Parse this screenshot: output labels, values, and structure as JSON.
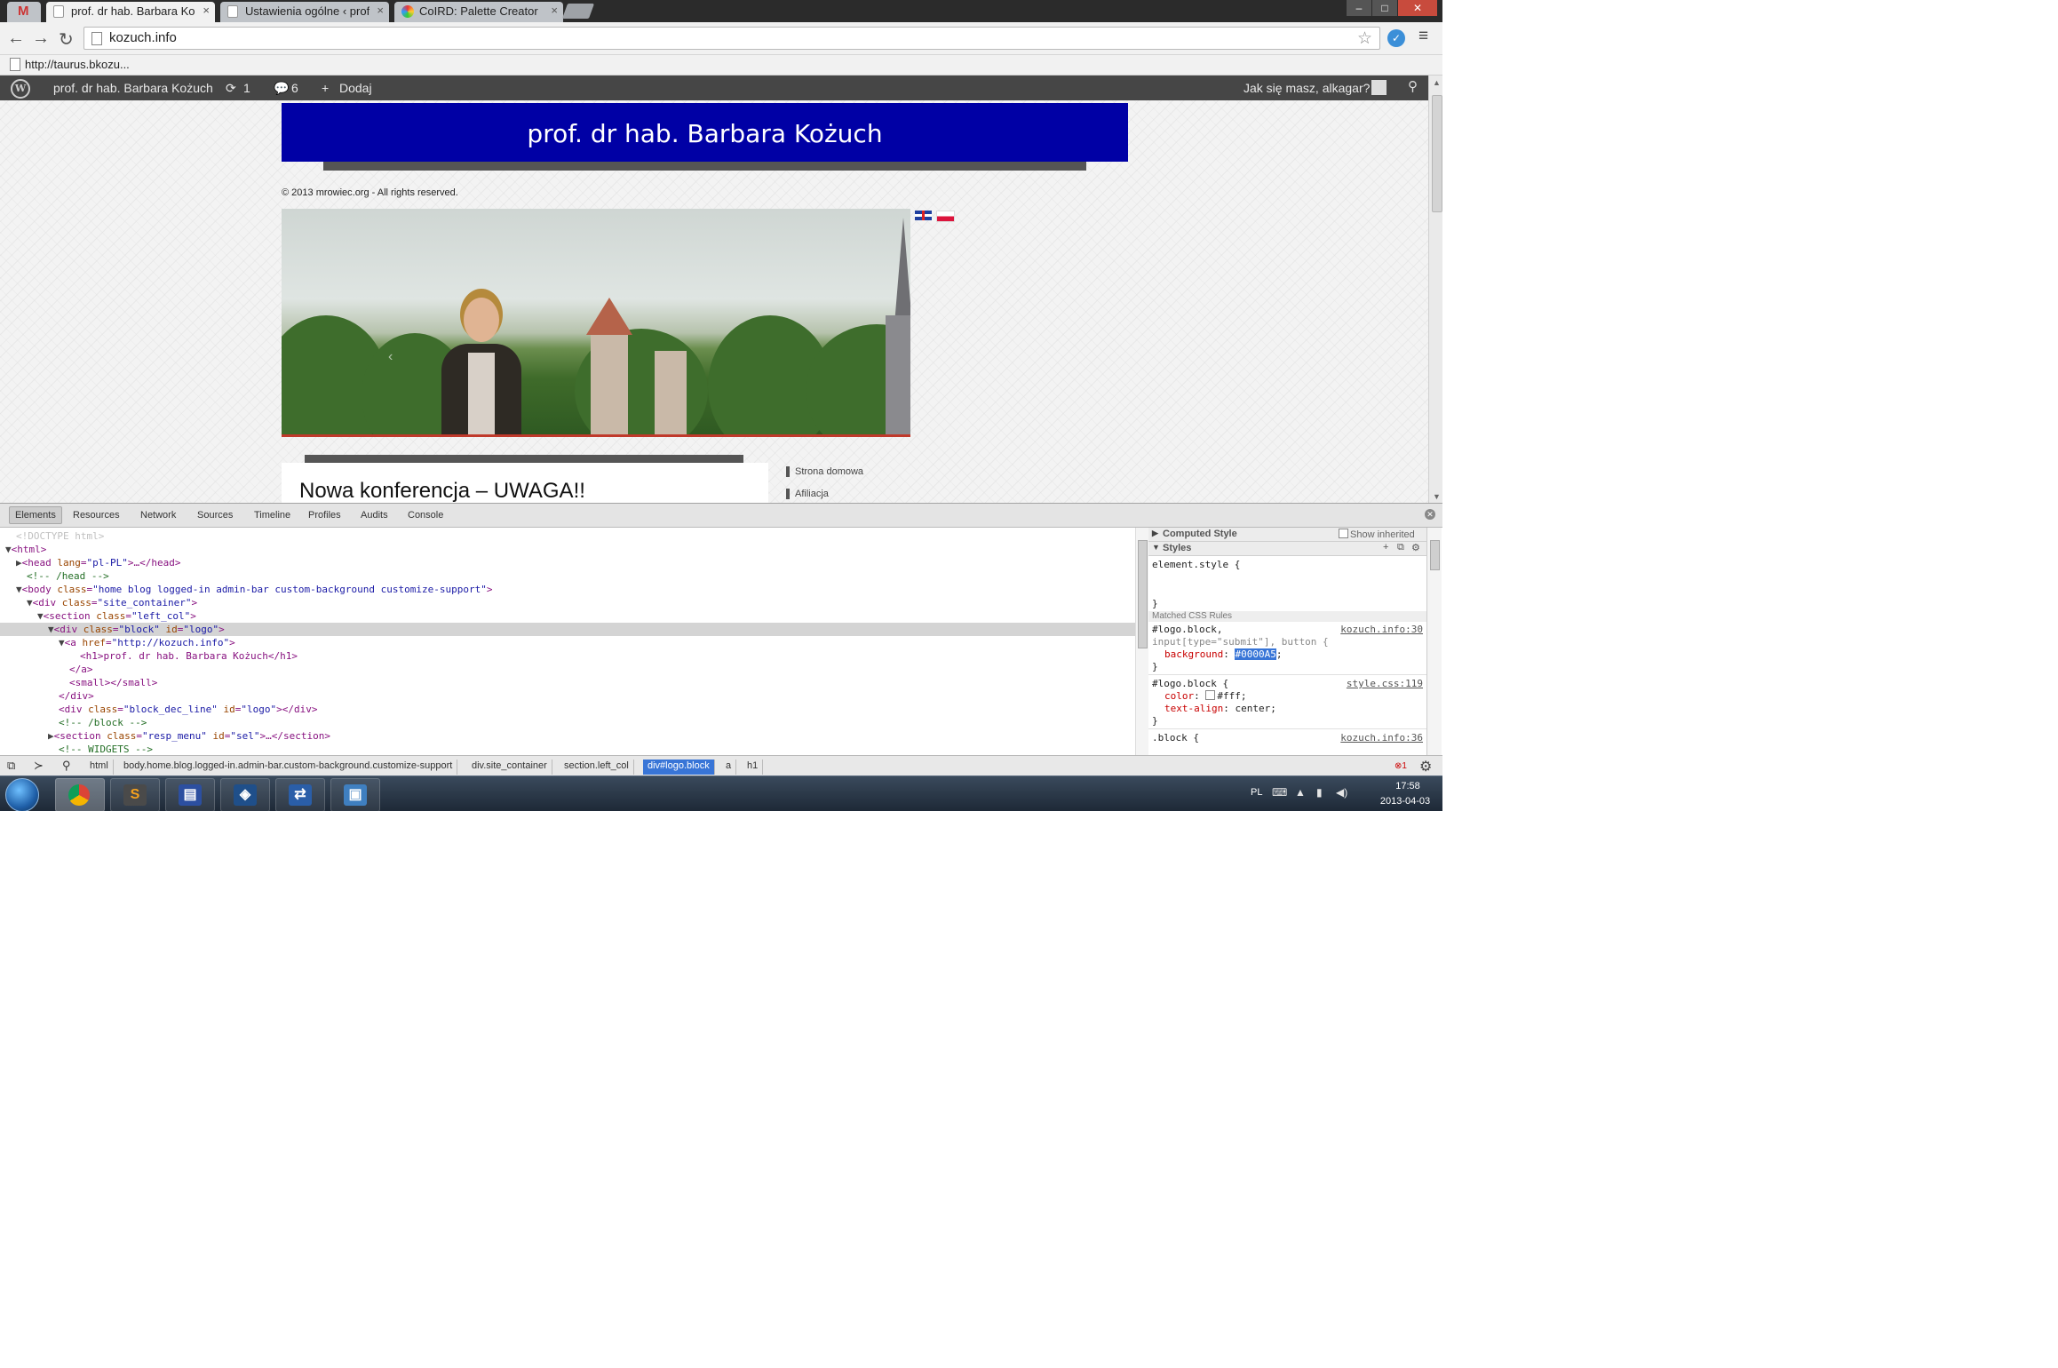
{
  "browser": {
    "tabs": [
      {
        "title": "prof. dr hab. Barbara Kożuc",
        "active": true
      },
      {
        "title": "Ustawienia ogólne ‹ prof.",
        "active": false
      },
      {
        "title": "CoIRD: Palette Creator",
        "active": false
      }
    ],
    "close_glyph": "×",
    "url": "kozuch.info",
    "bookmark": "http://taurus.bkozu..."
  },
  "admin_bar": {
    "site_name": "prof. dr hab. Barbara Kożuch",
    "updates_count": "1",
    "comments_count": "6",
    "add_new": "Dodaj",
    "greeting": "Jak się masz, alkagar?"
  },
  "site": {
    "logo_title": "prof. dr hab. Barbara Kożuch",
    "logo_color": "#0000A5",
    "copyright": "© 2013 mrowiec.org - All rights reserved.",
    "post_title": "Nowa konferencja – UWAGA!!",
    "sidebar": [
      "Strona domowa",
      "Afiliacja"
    ]
  },
  "devtools": {
    "tabs": [
      "Elements",
      "Resources",
      "Network",
      "Sources",
      "Timeline",
      "Profiles",
      "Audits",
      "Console"
    ],
    "dom": {
      "doctype": "<!DOCTYPE html>",
      "html_tag": "<html>",
      "head_open": "<head ",
      "lang_attr": "lang",
      "lang_val": "\"pl-PL\"",
      "head_close": ">…</head>",
      "comment_head": "<!-- /head -->",
      "body_open": "<body ",
      "class_attr": "class",
      "body_class": "\"home blog logged-in admin-bar custom-background customize-support\"",
      "tag_close": ">",
      "div_open": "<div ",
      "site_container": "\"site_container\"",
      "section_open": "<section ",
      "left_col": "\"left_col\"",
      "block_class": "\"block\"",
      "id_attr": "id",
      "logo_id": "\"logo\"",
      "a_open": "<a ",
      "href_attr": "href",
      "href_val": "\"http://kozuch.info\"",
      "h1_line": "<h1>prof. dr hab. Barbara Kożuch</h1>",
      "a_close": "</a>",
      "small_line": "<small></small>",
      "div_close": "</div>",
      "dec_line_class": "\"block_dec_line\"",
      "div_close_inline": "></div>",
      "comment_block": "<!-- /block -->",
      "resp_menu_class": "\"resp_menu\"",
      "sel_id": "\"sel\"",
      "section_close_inline": ">…</section>",
      "comment_widgets": "<!-- WIDGETS -->"
    },
    "styles": {
      "computed_label": "Computed Style",
      "show_inherited": "Show inherited",
      "styles_label": "Styles",
      "element_style": "element.style {",
      "close_brace": "}",
      "matched_label": "Matched CSS Rules",
      "rule1_selector_a": "#logo.block,",
      "rule1_selector_b": "input[type=\"submit\"], button {",
      "rule1_source": "kozuch.info:30",
      "rule1_prop": "background",
      "rule1_value": "#0000A5",
      "rule2_selector": "#logo.block {",
      "rule2_source": "style.css:119",
      "rule2_prop1": "color",
      "rule2_val1": "#fff;",
      "rule2_prop2": "text-align",
      "rule2_val2": "center;",
      "rule3_selector": ".block {",
      "rule3_source": "kozuch.info:36"
    },
    "breadcrumbs": [
      "html",
      "body.home.blog.logged-in.admin-bar.custom-background.customize-support",
      "div.site_container",
      "section.left_col",
      "div#logo.block",
      "a",
      "h1"
    ],
    "error_count": "1"
  },
  "taskbar": {
    "language": "PL",
    "time": "17:58",
    "date": "2013-04-03"
  }
}
